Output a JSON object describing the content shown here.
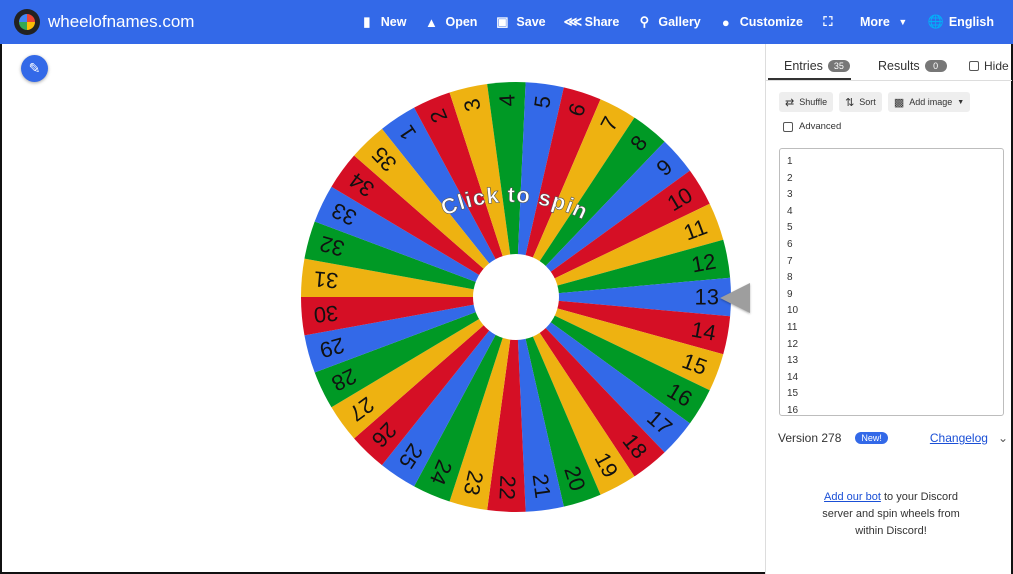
{
  "header": {
    "site_title": "wheelofnames.com",
    "nav": [
      {
        "label": "New",
        "icon": "file-icon"
      },
      {
        "label": "Open",
        "icon": "folder-open-icon"
      },
      {
        "label": "Save",
        "icon": "save-icon"
      },
      {
        "label": "Share",
        "icon": "share-icon"
      },
      {
        "label": "Gallery",
        "icon": "search-icon"
      },
      {
        "label": "Customize",
        "icon": "palette-icon"
      },
      {
        "label": "",
        "icon": "fullscreen-icon"
      },
      {
        "label": "More",
        "icon": "caret-down-icon"
      },
      {
        "label": "English",
        "icon": "globe-icon"
      }
    ]
  },
  "wheel": {
    "center_text": "Click to spin",
    "labels": [
      "1",
      "2",
      "3",
      "4",
      "5",
      "6",
      "7",
      "8",
      "9",
      "10",
      "11",
      "12",
      "13",
      "14",
      "15",
      "16",
      "17",
      "18",
      "19",
      "20",
      "21",
      "22",
      "23",
      "24",
      "25",
      "26",
      "27",
      "28",
      "29",
      "30",
      "31",
      "32",
      "33",
      "34",
      "35"
    ],
    "colors": [
      "#3369e8",
      "#d50f25",
      "#eeb211",
      "#009925"
    ],
    "pointer_label_index": 12
  },
  "sidebar": {
    "tabs": {
      "entries_label": "Entries",
      "entries_count": "35",
      "results_label": "Results",
      "results_count": "0",
      "hide_label": "Hide"
    },
    "toolbar": {
      "shuffle_label": "Shuffle",
      "sort_label": "Sort",
      "add_image_label": "Add image"
    },
    "advanced_label": "Advanced",
    "entries": [
      "1",
      "2",
      "3",
      "4",
      "5",
      "6",
      "7",
      "8",
      "9",
      "10",
      "11",
      "12",
      "13",
      "14",
      "15",
      "16"
    ],
    "version_label": "Version 278",
    "new_badge": "New!",
    "changelog_label": "Changelog",
    "discord": {
      "link_text": "Add our bot",
      "line1_rest": " to your Discord",
      "line2": "server and spin wheels from",
      "line3": "within Discord!"
    }
  }
}
